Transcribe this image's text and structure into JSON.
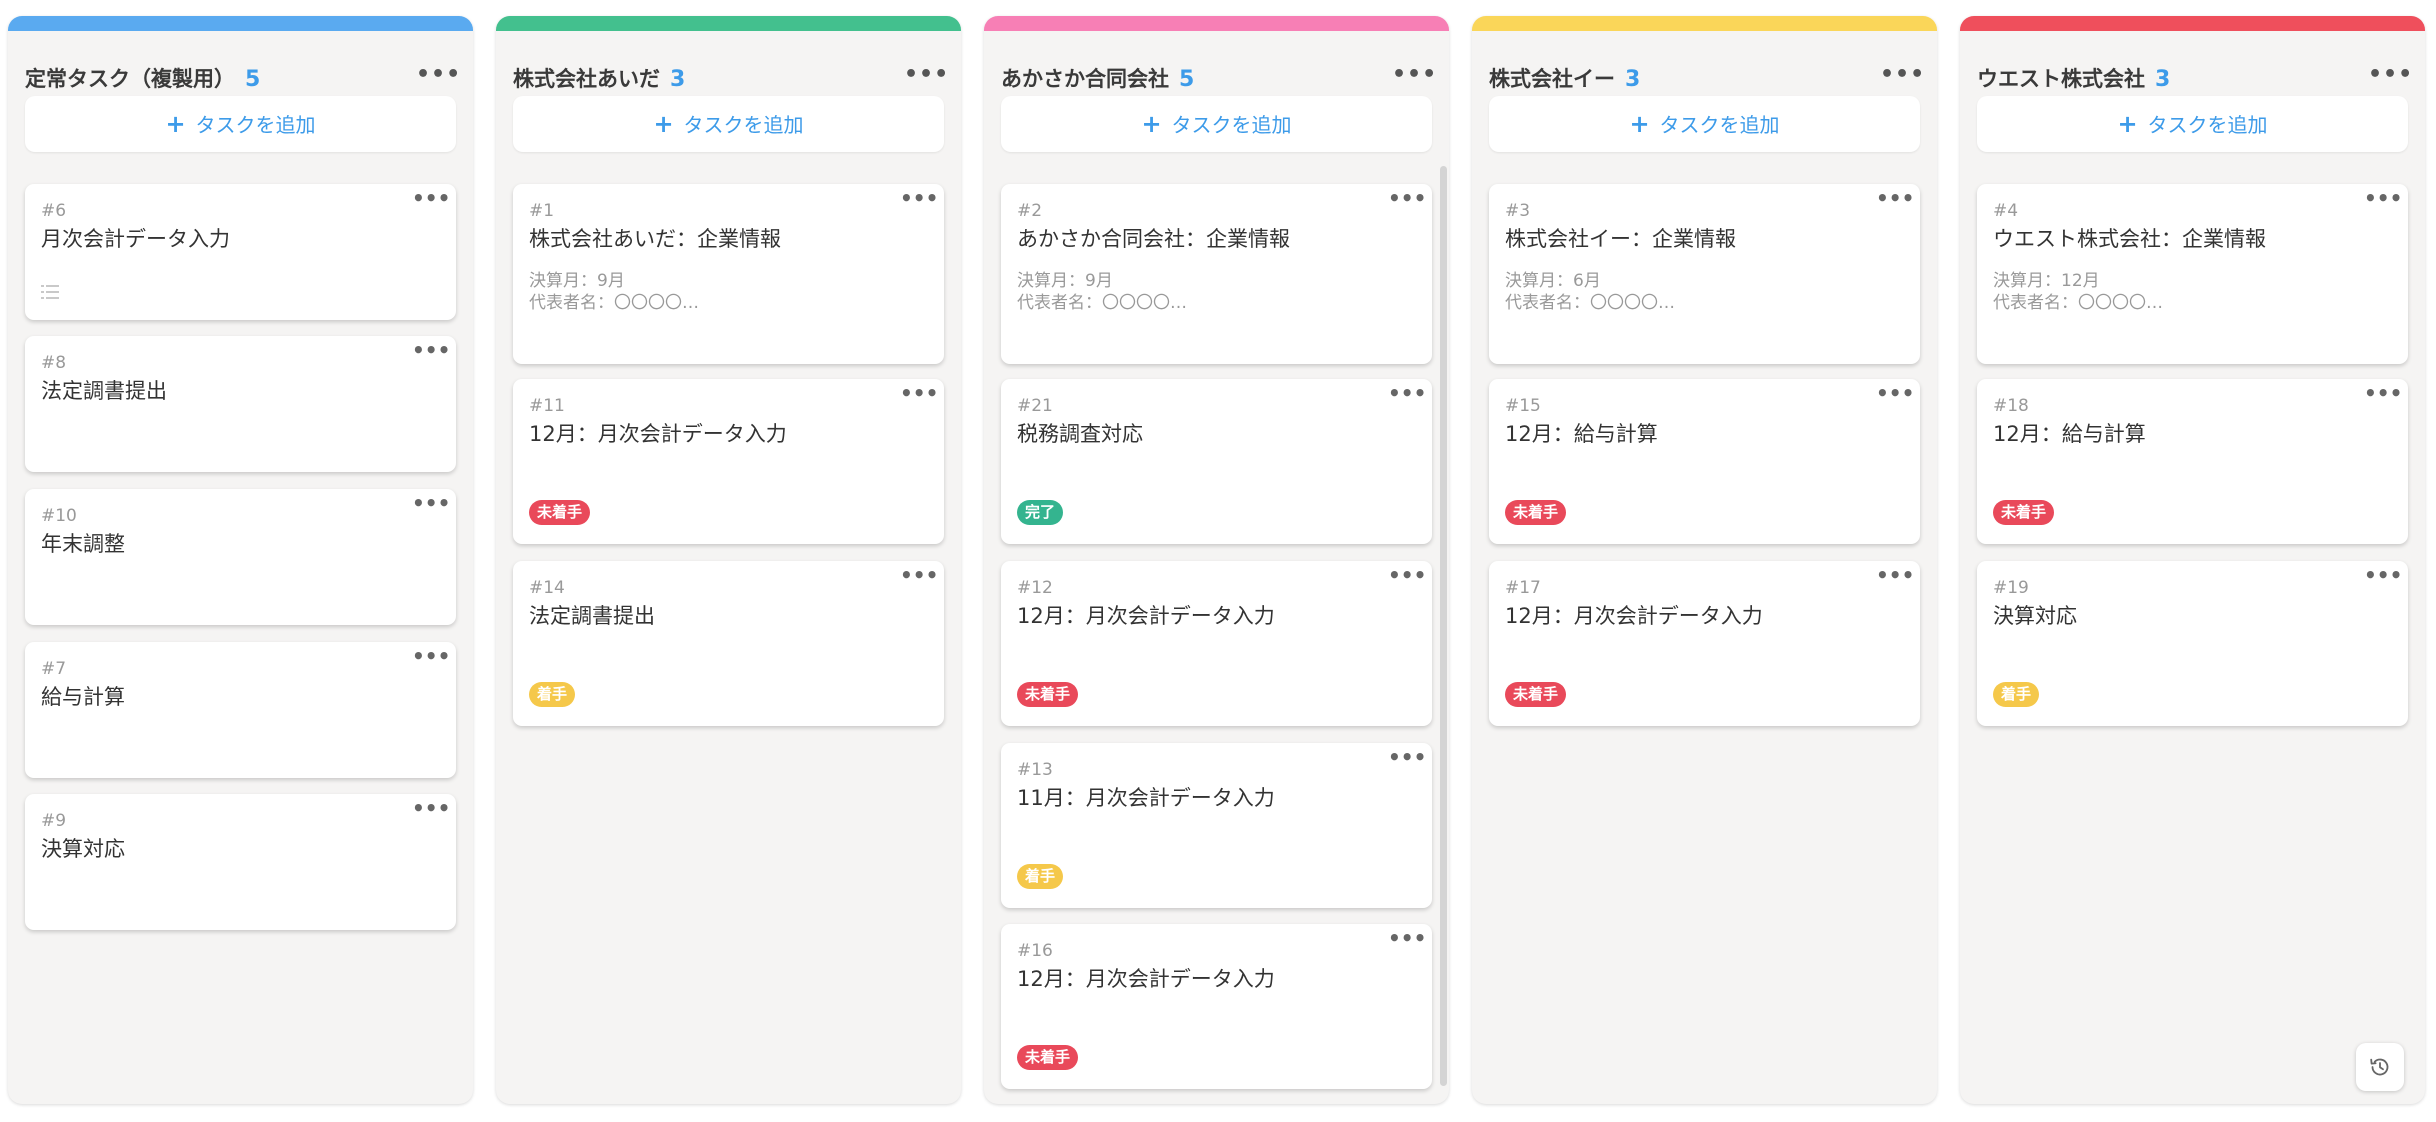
{
  "add_task_label": "タスクを追加",
  "status_colors": {
    "未着手": "#e9495a",
    "着手": "#f5c84a",
    "完了": "#34b48f"
  },
  "columns": [
    {
      "title": "定常タスク（複製用）",
      "count": "5",
      "color": "#5aaaf0",
      "cards": [
        {
          "id": "#6",
          "title": "月次会計データ入力",
          "has_list_icon": true
        },
        {
          "id": "#8",
          "title": "法定調書提出"
        },
        {
          "id": "#10",
          "title": "年末調整"
        },
        {
          "id": "#7",
          "title": "給与計算"
        },
        {
          "id": "#9",
          "title": "決算対応"
        }
      ]
    },
    {
      "title": "株式会社あいだ",
      "count": "3",
      "color": "#43c08e",
      "cards": [
        {
          "id": "#1",
          "title": "株式会社あいだ：企業情報",
          "meta": [
            "決算月：9月",
            "代表者名：〇〇〇〇…"
          ]
        },
        {
          "id": "#11",
          "title": "12月：月次会計データ入力",
          "status": "未着手"
        },
        {
          "id": "#14",
          "title": "法定調書提出",
          "status": "着手"
        }
      ]
    },
    {
      "title": "あかさか合同会社",
      "count": "5",
      "color": "#f77fb5",
      "cards": [
        {
          "id": "#2",
          "title": "あかさか合同会社：企業情報",
          "meta": [
            "決算月：9月",
            "代表者名：〇〇〇〇…"
          ]
        },
        {
          "id": "#21",
          "title": "税務調査対応",
          "status": "完了"
        },
        {
          "id": "#12",
          "title": "12月：月次会計データ入力",
          "status": "未着手"
        },
        {
          "id": "#13",
          "title": "11月：月次会計データ入力",
          "status": "着手"
        },
        {
          "id": "#16",
          "title": "12月：月次会計データ入力",
          "status": "未着手"
        }
      ]
    },
    {
      "title": "株式会社イー",
      "count": "3",
      "color": "#fad659",
      "cards": [
        {
          "id": "#3",
          "title": "株式会社イー：企業情報",
          "meta": [
            "決算月：6月",
            "代表者名：〇〇〇〇…"
          ]
        },
        {
          "id": "#15",
          "title": "12月：給与計算",
          "status": "未着手"
        },
        {
          "id": "#17",
          "title": "12月：月次会計データ入力",
          "status": "未着手"
        }
      ]
    },
    {
      "title": "ウエスト株式会社",
      "count": "3",
      "color": "#ef4f5c",
      "cards": [
        {
          "id": "#4",
          "title": "ウエスト株式会社：企業情報",
          "meta": [
            "決算月：12月",
            "代表者名：〇〇〇〇…"
          ]
        },
        {
          "id": "#18",
          "title": "12月：給与計算",
          "status": "未着手"
        },
        {
          "id": "#19",
          "title": "決算対応",
          "status": "着手"
        }
      ]
    }
  ]
}
